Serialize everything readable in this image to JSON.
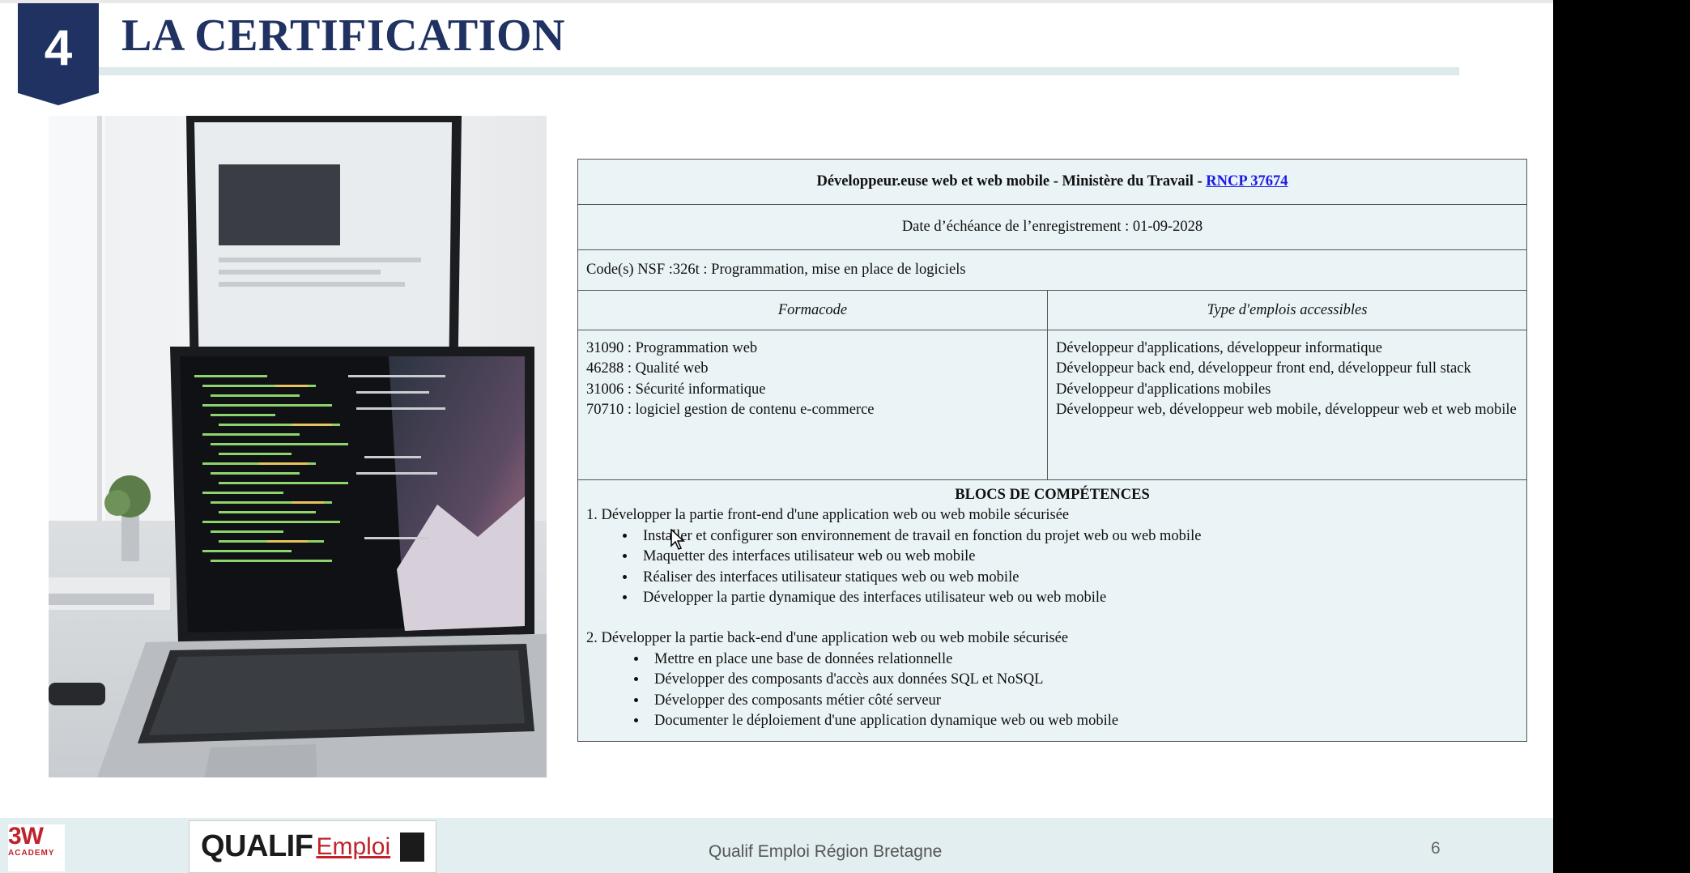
{
  "slide": {
    "section_number": "4",
    "title": "LA CERTIFICATION",
    "footer_text": "Qualif Emploi Région Bretagne",
    "page_number": "6"
  },
  "logos": {
    "academy_big": "3W",
    "academy_small": "ACADEMY",
    "qualif_bold": "QUALIF",
    "qualif_red": "Emploi"
  },
  "certification": {
    "title_prefix": "Développeur.euse web et web mobile - Ministère du Travail - ",
    "rncp_link": "RNCP 37674",
    "expiry": "Date d’échéance de l’enregistrement : 01-09-2028",
    "nsf": "Code(s) NSF :326t : Programmation, mise en place de logiciels",
    "formacode_header": "Formacode",
    "jobs_header": "Type d'emplois accessibles",
    "formacodes": [
      "31090 : Programmation web",
      "46288 : Qualité web",
      "31006 : Sécurité informatique",
      "70710 : logiciel gestion de contenu e-commerce"
    ],
    "jobs": [
      "Développeur d'applications, développeur informatique",
      "Développeur back end, développeur front end, développeur full stack",
      "Développeur d'applications mobiles",
      "Développeur web, développeur web mobile, développeur web et web mobile"
    ],
    "blocks_header": "BLOCS DE COMPÉTENCES",
    "block1_title": "1. Développer la partie front-end d'une application web ou web mobile sécurisée",
    "block1_items": [
      "Installer et configurer son environnement de travail en fonction du projet web ou web mobile",
      "Maquetter des interfaces utilisateur web ou web mobile",
      "Réaliser des interfaces utilisateur statiques web ou web mobile",
      "Développer la partie dynamique des interfaces utilisateur web ou web mobile"
    ],
    "block2_title": "2. Développer la partie back-end d'une application web ou web mobile sécurisée",
    "block2_items": [
      "Mettre en place une base de données relationnelle",
      "Développer des composants d'accès aux données SQL et NoSQL",
      "Développer des composants métier côté serveur",
      "Documenter le déploiement d'une application dynamique web ou web mobile"
    ]
  }
}
